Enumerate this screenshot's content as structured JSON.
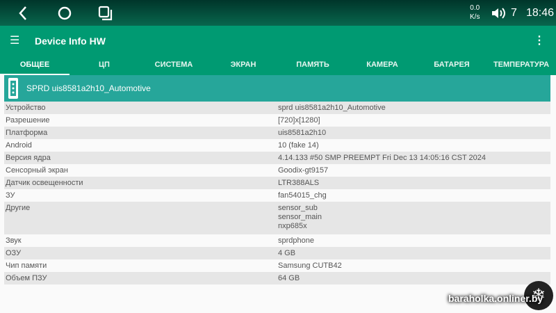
{
  "status": {
    "speed_value": "0.0",
    "speed_unit": "K/s",
    "volume": "7",
    "time": "18:46"
  },
  "app": {
    "title": "Device Info HW"
  },
  "tabs": [
    "ОБЩЕЕ",
    "ЦП",
    "СИСТЕМА",
    "ЭКРАН",
    "ПАМЯТЬ",
    "КАМЕРА",
    "БАТАРЕЯ",
    "ТЕМПЕРАТУРА"
  ],
  "card": {
    "title": "SPRD uis8581a2h10_Automotive"
  },
  "rows": [
    {
      "k": "Устройство",
      "v": "sprd uis8581a2h10_Automotive"
    },
    {
      "k": "Разрешение",
      "v": "[720]x[1280]"
    },
    {
      "k": "Платформа",
      "v": "uis8581a2h10"
    },
    {
      "k": "Android",
      "v": "10 (fake 14)"
    },
    {
      "k": "Версия ядра",
      "v": "4.14.133 #50 SMP PREEMPT Fri Dec 13 14:05:16 CST 2024"
    },
    {
      "k": "Сенсорный экран",
      "v": "Goodix-gt9157"
    },
    {
      "k": "Датчик освещенности",
      "v": "LTR388ALS"
    },
    {
      "k": "ЗУ",
      "v": "fan54015_chg"
    },
    {
      "k": "Другие",
      "v": "sensor_sub\nsensor_main\nnxp685x"
    },
    {
      "k": "Звук",
      "v": "sprdphone"
    },
    {
      "k": "ОЗУ",
      "v": "4 GB"
    },
    {
      "k": "Чип памяти",
      "v": "Samsung CUTB42"
    },
    {
      "k": "Объем ПЗУ",
      "v": "64 GB"
    }
  ],
  "watermark": "baraholka.onliner.by"
}
